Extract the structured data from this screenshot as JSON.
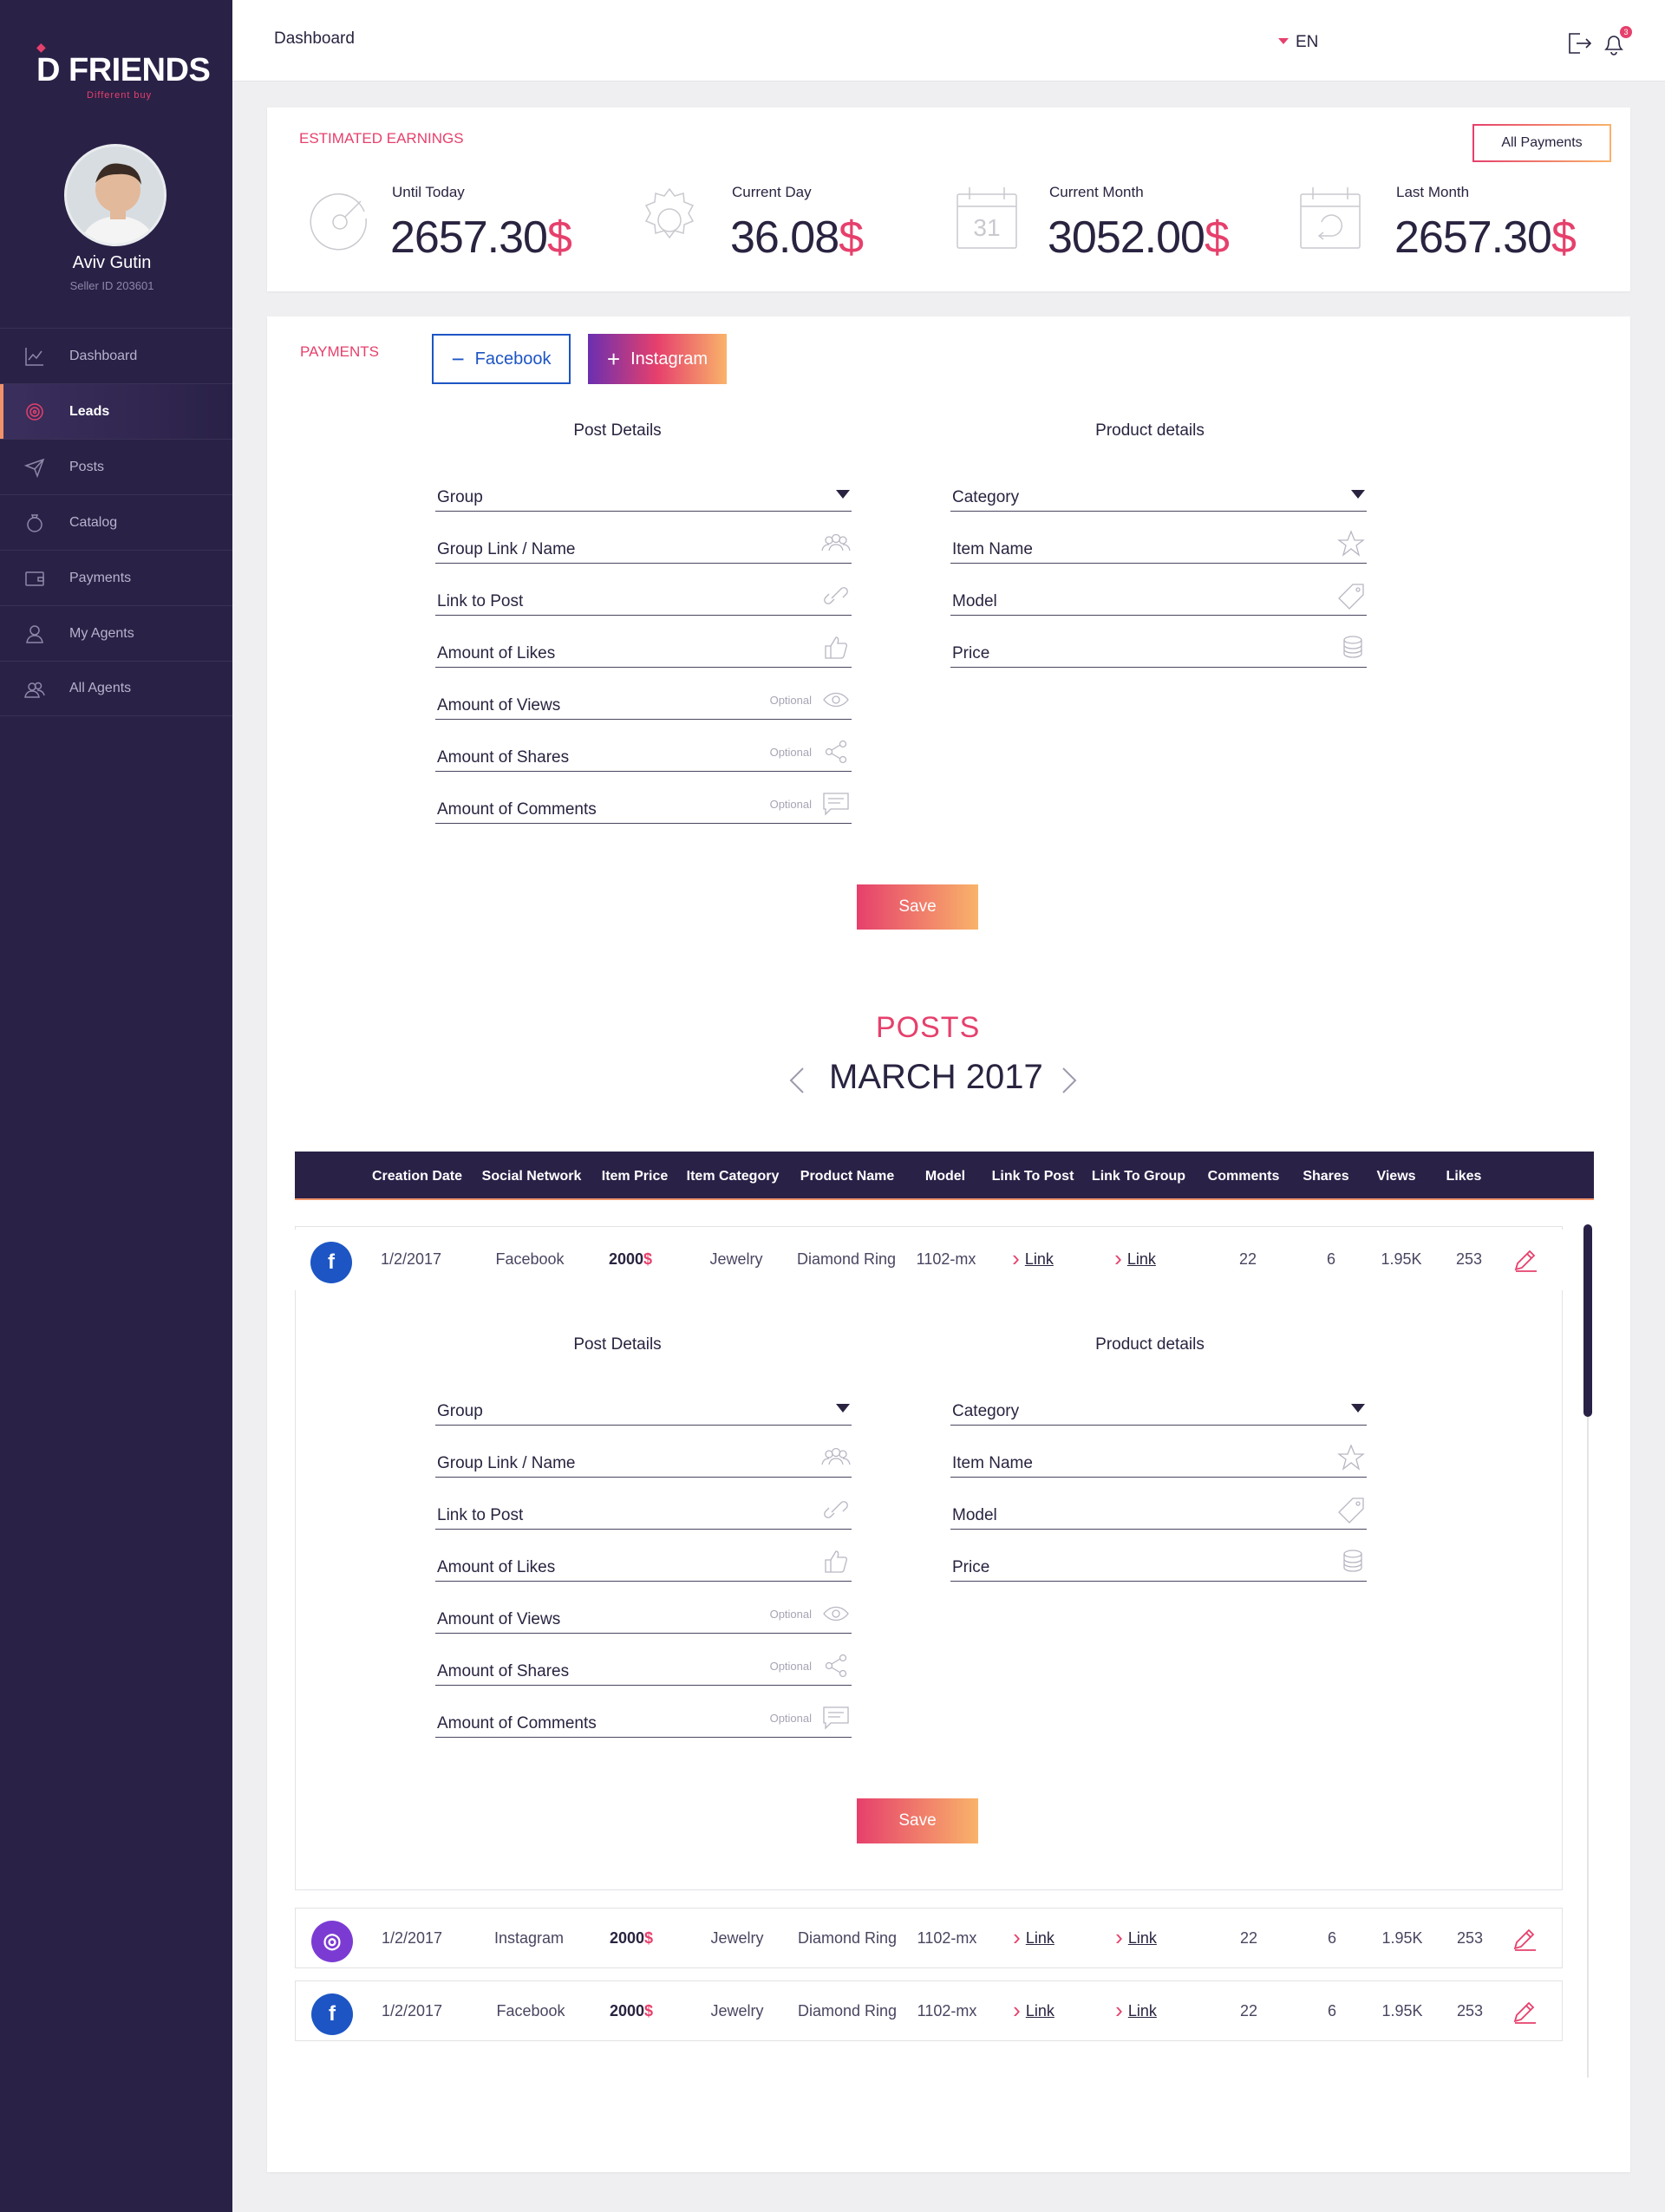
{
  "app": {
    "brand": "D FRIENDS",
    "tagline": "Different buy"
  },
  "user": {
    "name": "Aviv Gutin",
    "seller_id": "Seller ID 203601"
  },
  "sidebar": {
    "items": [
      {
        "label": "Dashboard",
        "icon": "chart-line-icon"
      },
      {
        "label": "Leads",
        "icon": "target-icon",
        "active": true
      },
      {
        "label": "Posts",
        "icon": "paper-plane-icon"
      },
      {
        "label": "Catalog",
        "icon": "ring-icon"
      },
      {
        "label": "Payments",
        "icon": "wallet-icon"
      },
      {
        "label": "My Agents",
        "icon": "user-icon"
      },
      {
        "label": "All Agents",
        "icon": "users-icon"
      }
    ]
  },
  "header": {
    "title": "Dashboard",
    "language": "EN",
    "notifications": "3"
  },
  "earnings": {
    "label": "ESTIMATED EARNINGS",
    "all_payments": "All Payments",
    "currency": "$",
    "items": [
      {
        "label": "Until Today",
        "value": "2657.30",
        "icon": "gauge-icon"
      },
      {
        "label": "Current Day",
        "value": "36.08",
        "icon": "sun-icon"
      },
      {
        "label": "Current Month",
        "value": "3052.00",
        "icon": "calendar-icon",
        "day": "31"
      },
      {
        "label": "Last Month",
        "value": "2657.30",
        "icon": "calendar-return-icon"
      }
    ]
  },
  "payments": {
    "label": "PAYMENTS",
    "facebook": "Facebook",
    "instagram": "Instagram",
    "minus": "−",
    "plus": "+"
  },
  "form": {
    "post_title": "Post Details",
    "product_title": "Product details",
    "post_fields": [
      {
        "label": "Group",
        "type": "select"
      },
      {
        "label": "Group Link / Name",
        "icon": "group-icon"
      },
      {
        "label": "Link to Post",
        "icon": "link-icon"
      },
      {
        "label": "Amount of Likes",
        "icon": "thumbs-up-icon"
      },
      {
        "label": "Amount of Views",
        "optional": "Optional",
        "icon": "eye-icon"
      },
      {
        "label": "Amount of Shares",
        "optional": "Optional",
        "icon": "share-icon"
      },
      {
        "label": "Amount of Comments",
        "optional": "Optional",
        "icon": "comment-icon"
      }
    ],
    "product_fields": [
      {
        "label": "Category",
        "type": "select"
      },
      {
        "label": "Item Name",
        "icon": "star-icon"
      },
      {
        "label": "Model",
        "icon": "tag-icon"
      },
      {
        "label": "Price",
        "icon": "coins-icon"
      }
    ],
    "save": "Save"
  },
  "posts": {
    "title": "POSTS",
    "month": "MARCH  2017",
    "columns": [
      "Creation Date",
      "Social Network",
      "Item Price",
      "Item Category",
      "Product Name",
      "Model",
      "Link To Post",
      "Link To Group",
      "Comments",
      "Shares",
      "Views",
      "Likes"
    ],
    "rows": [
      {
        "network": "Facebook",
        "date": "1/2/2017",
        "price": "2000",
        "currency": "$",
        "category": "Jewelry",
        "product": "Diamond Ring",
        "model": "1102-mx",
        "link_post": "Link",
        "link_group": "Link",
        "comments": "22",
        "shares": "6",
        "views": "1.95K",
        "likes": "253",
        "icon": "f"
      },
      {
        "network": "Instagram",
        "date": "1/2/2017",
        "price": "2000",
        "currency": "$",
        "category": "Jewelry",
        "product": "Diamond Ring",
        "model": "1102-mx",
        "link_post": "Link",
        "link_group": "Link",
        "comments": "22",
        "shares": "6",
        "views": "1.95K",
        "likes": "253",
        "icon": "◎"
      },
      {
        "network": "Facebook",
        "date": "1/2/2017",
        "price": "2000",
        "currency": "$",
        "category": "Jewelry",
        "product": "Diamond Ring",
        "model": "1102-mx",
        "link_post": "Link",
        "link_group": "Link",
        "comments": "22",
        "shares": "6",
        "views": "1.95K",
        "likes": "253",
        "icon": "f"
      }
    ]
  },
  "colors": {
    "accent": "#e6406c",
    "sidebar": "#2a2147",
    "facebook": "#1d55c4",
    "instagram": "#7b3bd3"
  }
}
